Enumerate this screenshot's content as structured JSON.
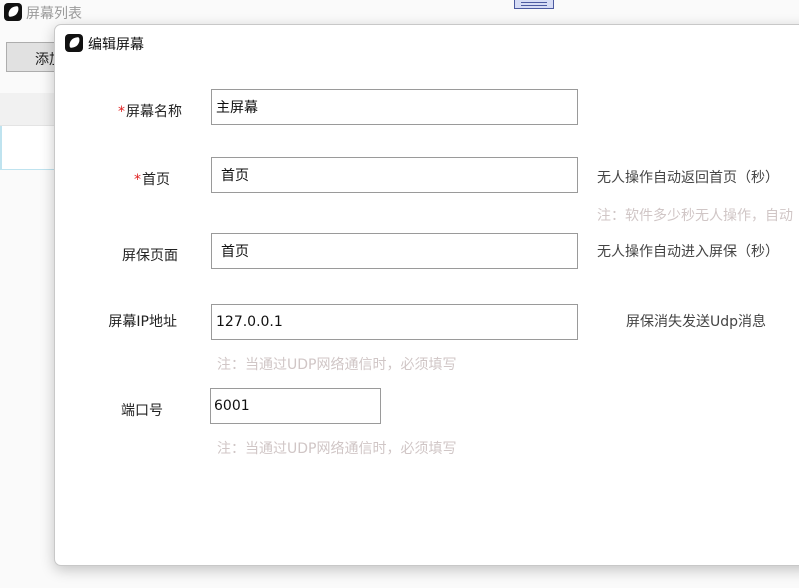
{
  "background": {
    "title": "屏幕列表",
    "add_button_label": "添加"
  },
  "dialog": {
    "title": "编辑屏幕",
    "fields": {
      "screen_name": {
        "label": "屏幕名称",
        "required": "*",
        "value": "主屏幕"
      },
      "home_page": {
        "label": "首页",
        "required": "*",
        "value": "首页"
      },
      "home_hint": "无人操作自动返回首页（秒）",
      "home_note": "注：软件多少秒无人操作，自动",
      "screensaver_page": {
        "label": "屏保页面",
        "value": "首页"
      },
      "screensaver_hint": "无人操作自动进入屏保（秒）",
      "screen_ip": {
        "label": "屏幕IP地址",
        "value": "127.0.0.1"
      },
      "ip_hint": "屏保消失发送Udp消息",
      "ip_note": "注：当通过UDP网络通信时，必须填写",
      "port": {
        "label": "端口号",
        "value": "6001"
      },
      "port_note": "注：当通过UDP网络通信时，必须填写"
    }
  },
  "colors": {
    "required_star": "#e02020",
    "note_text": "#d0c6c6"
  }
}
